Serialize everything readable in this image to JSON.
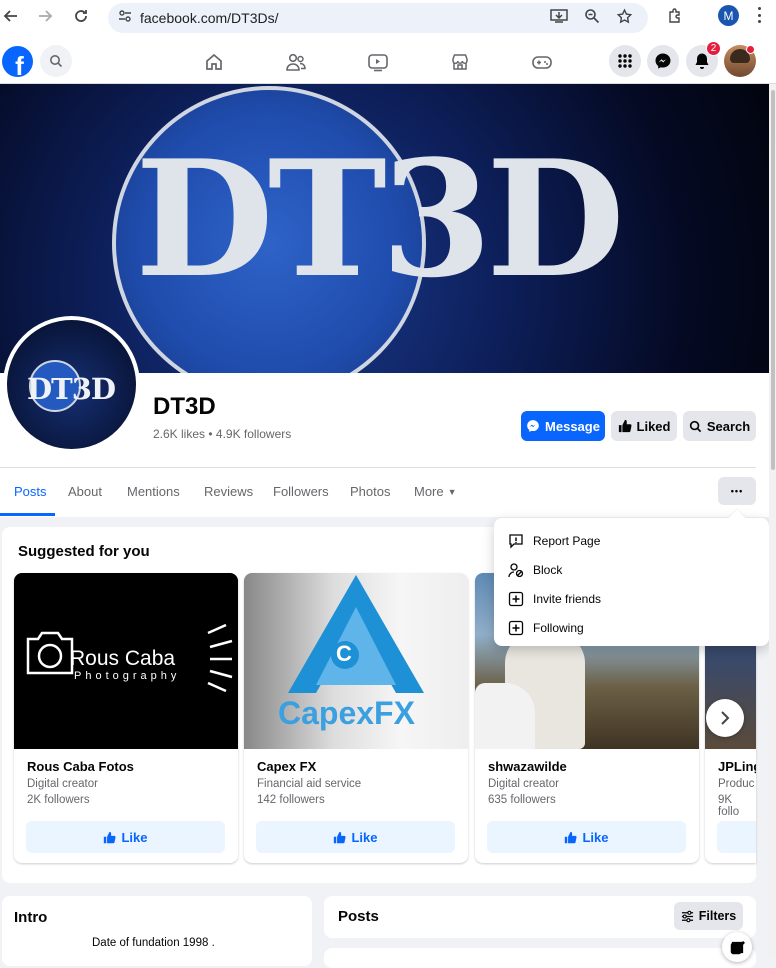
{
  "browser": {
    "url": "facebook.com/DT3Ds/",
    "profile_initial": "M"
  },
  "fb_nav": {
    "notification_count": "2",
    "logo_letter": "f"
  },
  "cover": {
    "text": "DT3D"
  },
  "profile": {
    "pic_text": "DT3D",
    "name": "DT3D",
    "stats": "2.6K likes • 4.9K followers"
  },
  "actions": {
    "message": "Message",
    "liked": "Liked",
    "search": "Search"
  },
  "tabs": {
    "posts": "Posts",
    "about": "About",
    "mentions": "Mentions",
    "reviews": "Reviews",
    "followers": "Followers",
    "photos": "Photos",
    "more": "More",
    "more_dots": "•••"
  },
  "menu": {
    "report": "Report Page",
    "block": "Block",
    "invite": "Invite friends",
    "following": "Following"
  },
  "suggested": {
    "title": "Suggested for you",
    "like_label": "Like",
    "cards": [
      {
        "name": "Rous Caba Fotos",
        "category": "Digital creator",
        "followers": "2K followers",
        "logo_main": "Rous Caba",
        "logo_sub": "Photography"
      },
      {
        "name": "Capex FX",
        "category": "Financial aid service",
        "followers": "142 followers",
        "logo_main": "CapexFX",
        "logo_letter": "C"
      },
      {
        "name": "shwazawilde",
        "category": "Digital creator",
        "followers": "635 followers"
      },
      {
        "name": "JPLing",
        "category": "Produc",
        "followers": "9K follo"
      }
    ]
  },
  "intro": {
    "title": "Intro",
    "text": "Date of fundation 1998 ."
  },
  "posts": {
    "title": "Posts",
    "filters": "Filters"
  },
  "colors": {
    "fb_blue": "#0866ff",
    "bg": "#f0f2f5",
    "notification_red": "#e41e3f"
  }
}
